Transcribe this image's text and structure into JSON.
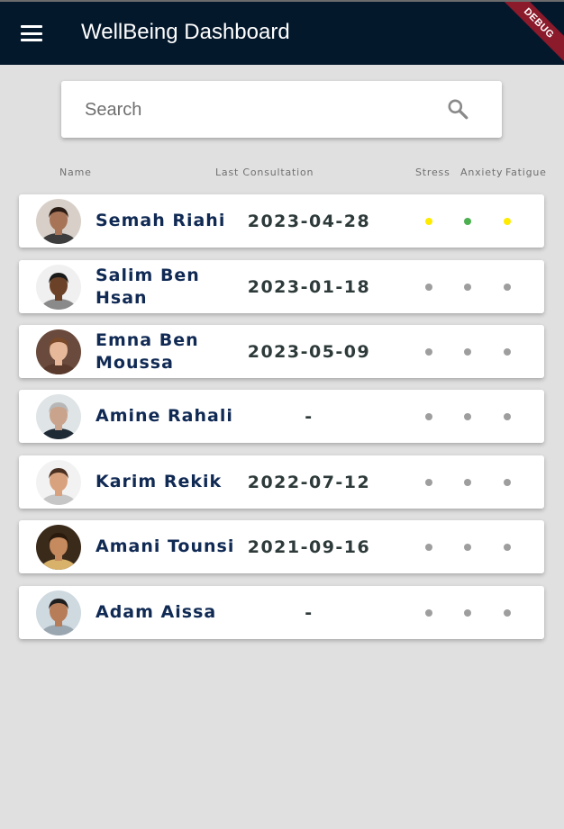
{
  "app": {
    "title": "WellBeing Dashboard",
    "debug_label": "DEBUG"
  },
  "search": {
    "placeholder": "Search"
  },
  "columns": {
    "name": "Name",
    "last_consultation": "Last Consultation",
    "stress": "Stress",
    "anxiety": "Anxiety",
    "fatigue": "Fatigue"
  },
  "colors": {
    "appbar": "#04182c",
    "background": "#e0e0e0",
    "name_text": "#102a54",
    "date_text": "#2e3a3a",
    "indicator_inactive": "#9e9e9e",
    "indicator_yellow": "#ffeb00",
    "indicator_green": "#4caf50"
  },
  "patients": [
    {
      "name": "Semah Riahi",
      "last_consultation": "2023-04-28",
      "stress": "yellow",
      "anxiety": "green",
      "fatigue": "yellow"
    },
    {
      "name": "Salim Ben Hsan",
      "last_consultation": "2023-01-18",
      "stress": "inactive",
      "anxiety": "inactive",
      "fatigue": "inactive"
    },
    {
      "name": "Emna Ben Moussa",
      "last_consultation": "2023-05-09",
      "stress": "inactive",
      "anxiety": "inactive",
      "fatigue": "inactive"
    },
    {
      "name": "Amine Rahali",
      "last_consultation": "-",
      "stress": "inactive",
      "anxiety": "inactive",
      "fatigue": "inactive"
    },
    {
      "name": "Karim Rekik",
      "last_consultation": "2022-07-12",
      "stress": "inactive",
      "anxiety": "inactive",
      "fatigue": "inactive"
    },
    {
      "name": "Amani Tounsi",
      "last_consultation": "2021-09-16",
      "stress": "inactive",
      "anxiety": "inactive",
      "fatigue": "inactive"
    },
    {
      "name": "Adam Aissa",
      "last_consultation": "-",
      "stress": "inactive",
      "anxiety": "inactive",
      "fatigue": "inactive"
    }
  ]
}
